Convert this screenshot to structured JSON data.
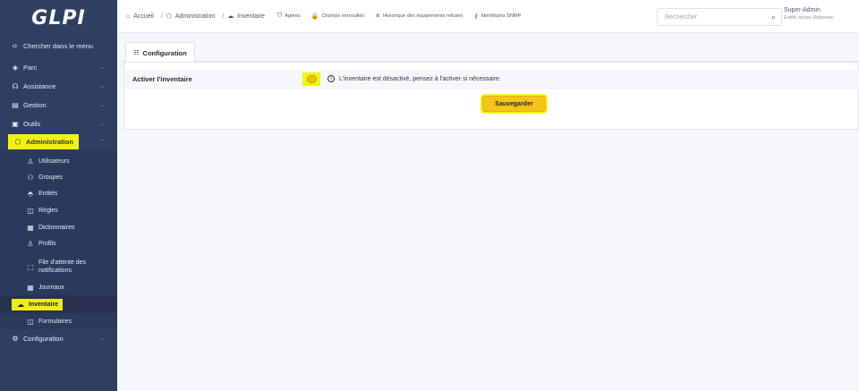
{
  "app": {
    "logo": "GLPI"
  },
  "sidebar": {
    "items": [
      {
        "label": "Chercher dans le menu",
        "icon": "share-arrow-icon",
        "glyph": "➪"
      },
      {
        "label": "Parc",
        "icon": "parc-icon",
        "glyph": "◈"
      },
      {
        "label": "Assistance",
        "icon": "headset-icon",
        "glyph": "☊"
      },
      {
        "label": "Gestion",
        "icon": "wallet-icon",
        "glyph": "▤"
      },
      {
        "label": "Outils",
        "icon": "briefcase-icon",
        "glyph": "▣"
      },
      {
        "label": "Administration",
        "icon": "shield-icon",
        "glyph": "⬡"
      }
    ],
    "admin_sub": [
      {
        "label": "Utilisateurs",
        "glyph": "♙"
      },
      {
        "label": "Groupes",
        "glyph": "⚇"
      },
      {
        "label": "Entités",
        "glyph": "⬘"
      },
      {
        "label": "Règles",
        "glyph": "◫"
      },
      {
        "label": "Dictionnaires",
        "glyph": "▦"
      },
      {
        "label": "Profils",
        "glyph": "♙"
      },
      {
        "label": "File d'attente des",
        "label2": "notifications",
        "glyph": "⬚"
      },
      {
        "label": "Journaux",
        "glyph": "▦"
      },
      {
        "label": "Inventaire",
        "glyph": "☁"
      },
      {
        "label": "Formulaires",
        "glyph": "◫"
      }
    ],
    "config": {
      "label": "Configuration",
      "glyph": "⚙"
    }
  },
  "breadcrumb": {
    "home": "Accueil",
    "admin": "Administration",
    "current": "Inventaire"
  },
  "quick_links": [
    {
      "label": "Agents",
      "glyph": "⛉"
    },
    {
      "label": "Champs verrouillés",
      "glyph": "🔒"
    },
    {
      "label": "Historique des équipements refusés",
      "glyph": "✕"
    },
    {
      "label": "Identifiants SNMP",
      "glyph": "⚷"
    }
  ],
  "search": {
    "placeholder": "Rechercher"
  },
  "user": {
    "name": "Super-Admin",
    "entity": "Entité racine (Arboresc"
  },
  "tab": {
    "label": "Configuration"
  },
  "form": {
    "label": "Activer l'inventaire",
    "info": "L'inventaire est désactivé, pensez à l'activer si nécessaire.",
    "save": "Sauvegarder"
  }
}
